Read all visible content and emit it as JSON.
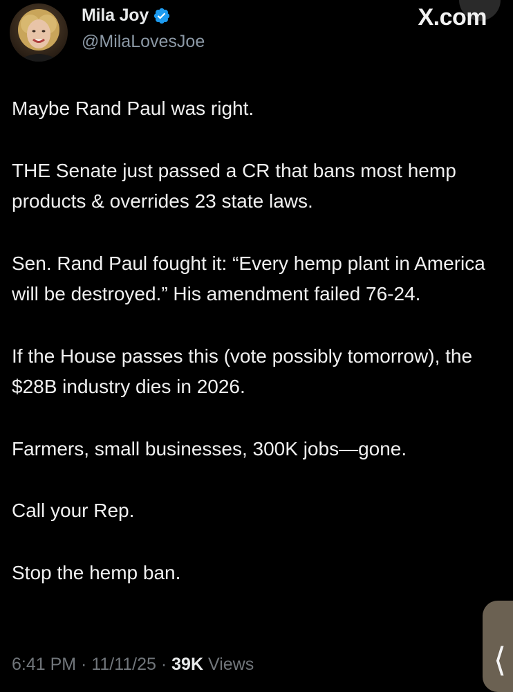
{
  "author": {
    "display_name": "Mila Joy",
    "handle": "@MilaLovesJoe",
    "verified": true,
    "avatar_icon": "profile-photo"
  },
  "watermark": "X.com",
  "tweet": {
    "paragraphs": [
      "Maybe Rand Paul was right.",
      "THE Senate just passed a CR that bans most hemp products & overrides 23 state laws.",
      "Sen. Rand Paul fought it: “Every hemp plant in America will be destroyed.” His amendment failed 76-24.",
      "If the House passes this (vote possibly tomorrow), the $28B industry dies in 2026.",
      "Farmers, small businesses, 300K jobs—gone.",
      "Call your Rep.",
      "Stop the hemp ban."
    ]
  },
  "meta": {
    "time": "6:41 PM",
    "separator": " · ",
    "date": "11/11/25",
    "views_count": "39K",
    "views_label": " Views"
  },
  "side_tab": {
    "glyph": "⟨",
    "icon": "chevron-left-icon"
  },
  "colors": {
    "background": "#000000",
    "text": "#f0f0f0",
    "muted": "#71767b",
    "verified_blue": "#1d9bf0"
  }
}
